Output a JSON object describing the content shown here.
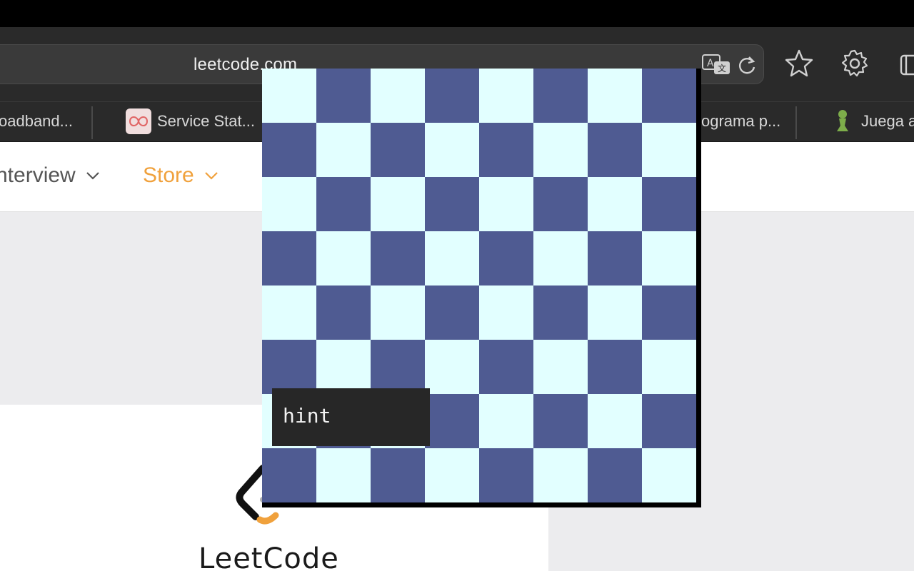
{
  "browser": {
    "url": "leetcode.com",
    "bookmarks": [
      {
        "label": "oadband..."
      },
      {
        "label": "Service Stat..."
      },
      {
        "label": "ograma p..."
      },
      {
        "label": "Juega a"
      }
    ]
  },
  "site_nav": {
    "items": [
      {
        "label": "nterview"
      },
      {
        "label": "Store"
      }
    ]
  },
  "logo": {
    "text": "LeetCode"
  },
  "game": {
    "rows": 8,
    "cols": 8,
    "light_color": "#e2ffff",
    "dark_color": "#4f5b92",
    "hint_label": "hint"
  },
  "colors": {
    "accent_store": "#f0a13c",
    "toolbar_bg": "#2a2a2a"
  }
}
